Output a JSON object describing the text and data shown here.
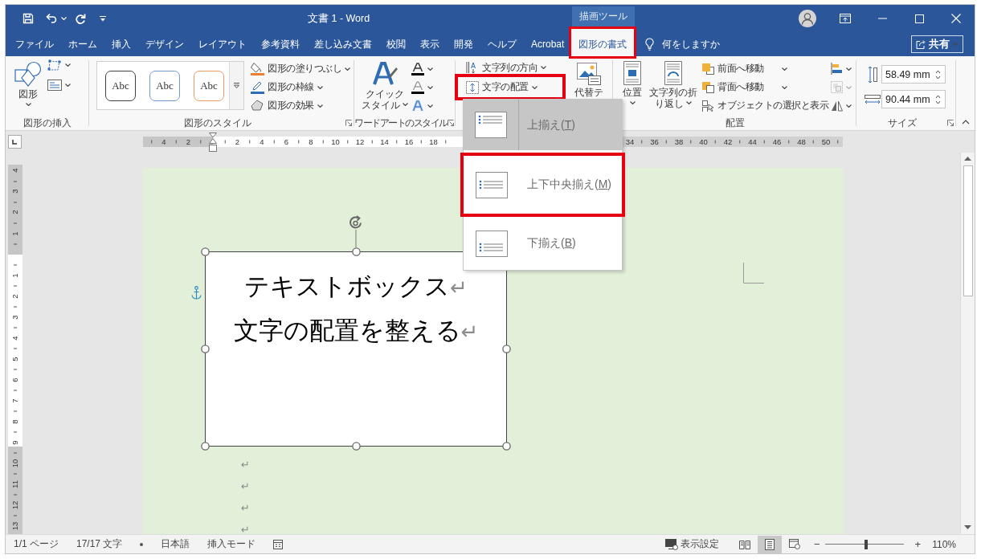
{
  "window": {
    "title": "文書 1 - Word",
    "contextual_header": "描画ツール"
  },
  "tabs": [
    {
      "label": "ファイル",
      "selected": false,
      "highlighted": false
    },
    {
      "label": "ホーム",
      "selected": false,
      "highlighted": false
    },
    {
      "label": "挿入",
      "selected": false,
      "highlighted": false
    },
    {
      "label": "デザイン",
      "selected": false,
      "highlighted": false
    },
    {
      "label": "レイアウト",
      "selected": false,
      "highlighted": false
    },
    {
      "label": "参考資料",
      "selected": false,
      "highlighted": false
    },
    {
      "label": "差し込み文書",
      "selected": false,
      "highlighted": false
    },
    {
      "label": "校閲",
      "selected": false,
      "highlighted": false
    },
    {
      "label": "表示",
      "selected": false,
      "highlighted": false
    },
    {
      "label": "開発",
      "selected": false,
      "highlighted": false
    },
    {
      "label": "ヘルプ",
      "selected": false,
      "highlighted": false
    },
    {
      "label": "Acrobat",
      "selected": false,
      "highlighted": false
    },
    {
      "label": "図形の書式",
      "selected": true,
      "highlighted": true
    }
  ],
  "tell_me": {
    "placeholder": "何をしますか"
  },
  "share_button": {
    "label": "共有"
  },
  "ribbon_groups": [
    {
      "kind": "insert_shapes",
      "label": "図形の挿入",
      "dialog_launcher": false,
      "large_button": {
        "lines": [
          "図形"
        ]
      }
    },
    {
      "kind": "shape_styles",
      "label": "図形のスタイル",
      "dialog_launcher": true,
      "style_presets": [
        {
          "label": "Abc",
          "color": "#404040"
        },
        {
          "label": "Abc",
          "color": "#7398cc"
        },
        {
          "label": "Abc",
          "color": "#ed9a62"
        }
      ],
      "commands": [
        {
          "label": "図形の塗りつぶし"
        },
        {
          "label": "図形の枠線"
        },
        {
          "label": "図形の効果"
        }
      ]
    },
    {
      "kind": "wordart_styles",
      "label": "ワードアートのスタイル",
      "dialog_launcher": true,
      "large_button": {
        "lines": [
          "クイック",
          "スタイル"
        ]
      }
    },
    {
      "kind": "text",
      "commands": [
        {
          "label": "文字列の方向",
          "highlighted": false
        },
        {
          "label": "文字の配置",
          "highlighted": true
        }
      ]
    },
    {
      "kind": "accessibility",
      "large_button": {
        "lines": [
          "代替テ"
        ]
      }
    },
    {
      "kind": "arrange",
      "label": "配置",
      "dialog_launcher": false,
      "large_buttons": [
        {
          "lines": [
            "位置"
          ]
        },
        {
          "lines": [
            "文字列の折",
            "り返し"
          ]
        }
      ],
      "commands": [
        {
          "label": "前面へ移動",
          "dropdown": true
        },
        {
          "label": "背面へ移動",
          "dropdown": true
        },
        {
          "label": "オブジェクトの選択と表示",
          "dropdown": false
        }
      ],
      "icon_commands": [
        {
          "disabled": false
        },
        {
          "disabled": true
        },
        {
          "disabled": false
        }
      ]
    },
    {
      "kind": "size",
      "label": "サイズ",
      "dialog_launcher": true,
      "fields": [
        {
          "value": "58.49 mm"
        },
        {
          "value": "90.44 mm"
        }
      ]
    }
  ],
  "text_alignment_menu": {
    "items": [
      {
        "label": "上揃え(",
        "access_key": "T",
        "label_end": ")",
        "selected": true,
        "highlighted": false
      },
      {
        "label": "上下中央揃え(",
        "access_key": "M",
        "label_end": ")",
        "selected": false,
        "highlighted": true
      },
      {
        "label": "下揃え(",
        "access_key": "B",
        "label_end": ")",
        "selected": false,
        "highlighted": false
      }
    ]
  },
  "horizontal_ruler": {
    "left_labels": [
      "4",
      "2"
    ],
    "labels": [
      "2",
      "4",
      "6",
      "8",
      "10",
      "12",
      "14",
      "16",
      "18"
    ],
    "right_labels": [
      "34",
      "36",
      "38",
      "40",
      "42",
      "44",
      "46",
      "48",
      "50"
    ]
  },
  "vertical_ruler": {
    "top_labels": [
      "4",
      "3",
      "2",
      "1"
    ],
    "labels": [
      "1",
      "2",
      "3",
      "4",
      "5",
      "6",
      "7",
      "8"
    ],
    "bottom_labels": [
      "9",
      "10",
      "11",
      "12",
      "13"
    ]
  },
  "text_box": {
    "paragraphs": [
      {
        "text": "テキストボックス",
        "mark": "↵"
      },
      {
        "text": "文字の配置を整える",
        "mark": "↵"
      }
    ]
  },
  "empty_paragraphs": [
    {
      "mark": "↵"
    },
    {
      "mark": "↵"
    },
    {
      "mark": "↵"
    },
    {
      "mark": "↵"
    }
  ],
  "status_bar": {
    "items": [
      {
        "kind": "text",
        "label": "1/1 ページ"
      },
      {
        "kind": "text",
        "label": "17/17 文字"
      },
      {
        "kind": "proofing"
      },
      {
        "kind": "text",
        "label": "日本語"
      },
      {
        "kind": "text",
        "label": "挿入モード"
      },
      {
        "kind": "macro"
      }
    ],
    "display_settings": {
      "label": "表示設定"
    },
    "view_buttons": [
      {
        "selected": false
      },
      {
        "selected": true
      },
      {
        "selected": false
      }
    ],
    "zoom": {
      "minus": "−",
      "plus": "+",
      "level": 0.52,
      "percent": "110%"
    }
  }
}
